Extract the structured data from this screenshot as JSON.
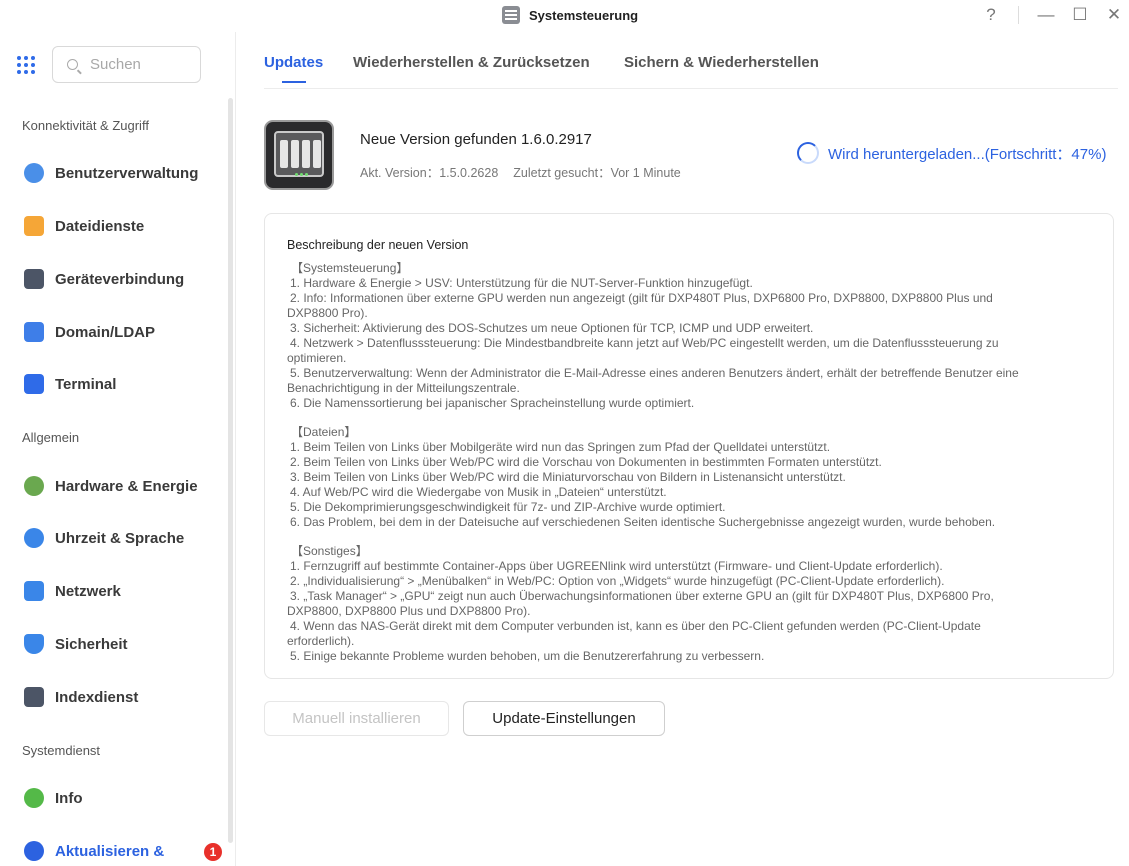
{
  "window": {
    "title": "Systemsteuerung",
    "controls": {
      "help": "?",
      "minimize": "—",
      "maximize": "☐",
      "close": "✕"
    }
  },
  "sidebar": {
    "search_placeholder": "Suchen",
    "sections": [
      "Konnektivität & Zugriff",
      "Allgemein",
      "Systemdienst"
    ],
    "items": [
      {
        "label": "Benutzerverwaltung",
        "icon": "users-icon",
        "color": "#4a8fe8"
      },
      {
        "label": "Dateidienste",
        "icon": "folder-icon",
        "color": "#f5a637"
      },
      {
        "label": "Geräteverbindung",
        "icon": "device-icon",
        "color": "#4c5566"
      },
      {
        "label": "Domain/LDAP",
        "icon": "domain-icon",
        "color": "#3e7ee8"
      },
      {
        "label": "Terminal",
        "icon": "terminal-icon",
        "color": "#2f6be8"
      },
      {
        "label": "Hardware & Energie",
        "icon": "hardware-icon",
        "color": "#6aa84f"
      },
      {
        "label": "Uhrzeit & Sprache",
        "icon": "globe-icon",
        "color": "#3a86e8"
      },
      {
        "label": "Netzwerk",
        "icon": "network-icon",
        "color": "#3a86e8"
      },
      {
        "label": "Sicherheit",
        "icon": "shield-icon",
        "color": "#3a86e8"
      },
      {
        "label": "Indexdienst",
        "icon": "index-icon",
        "color": "#4c5566"
      },
      {
        "label": "Info",
        "icon": "info-icon",
        "color": "#54b948"
      },
      {
        "label": "Aktualisieren &",
        "icon": "update-icon",
        "color": "#2c62e0",
        "badge": "1"
      }
    ]
  },
  "tabs": [
    {
      "label": "Updates"
    },
    {
      "label": "Wiederherstellen & Zurücksetzen"
    },
    {
      "label": "Sichern & Wiederherstellen"
    }
  ],
  "update": {
    "new_version": "Neue Version gefunden 1.6.0.2917",
    "current_version": "Akt. Version：1.5.0.2628",
    "last_checked": "Zuletzt gesucht：Vor 1 Minute",
    "progress_text": "Wird heruntergeladen...(Fortschritt：47%)",
    "progress_percent": 47
  },
  "notes": {
    "title": "Beschreibung der neuen Version",
    "groups": [
      [
        "【Systemsteuerung】",
        "1. Hardware & Energie > USV: Unterstützung für die NUT-Server-Funktion hinzugefügt.",
        "2. Info: Informationen über externe GPU werden nun angezeigt (gilt für DXP480T Plus, DXP6800 Pro, DXP8800, DXP8800 Plus und",
        "DXP8800 Pro).",
        "3. Sicherheit: Aktivierung des DOS-Schutzes um neue Optionen für TCP, ICMP und UDP erweitert.",
        "4. Netzwerk > Datenflusssteuerung: Die Mindestbandbreite kann jetzt auf Web/PC eingestellt werden, um die Datenflusssteuerung zu",
        "optimieren.",
        "5. Benutzerverwaltung: Wenn der Administrator die E-Mail-Adresse eines anderen Benutzers ändert, erhält der betreffende Benutzer eine",
        "Benachrichtigung in der Mitteilungszentrale.",
        "6. Die Namenssortierung bei japanischer Spracheinstellung wurde optimiert."
      ],
      [
        "【Dateien】",
        "1. Beim Teilen von Links über Mobilgeräte wird nun das Springen zum Pfad der Quelldatei unterstützt.",
        "2. Beim Teilen von Links über Web/PC wird die Vorschau von Dokumenten in bestimmten Formaten unterstützt.",
        "3. Beim Teilen von Links über Web/PC wird die Miniaturvorschau von Bildern in Listenansicht unterstützt.",
        "4. Auf Web/PC wird die Wiedergabe von Musik in „Dateien“ unterstützt.",
        "5. Die Dekomprimierungsgeschwindigkeit für 7z- und ZIP-Archive wurde optimiert.",
        "6. Das Problem, bei dem in der Dateisuche auf verschiedenen Seiten identische Suchergebnisse angezeigt wurden, wurde behoben."
      ],
      [
        "【Sonstiges】",
        "1. Fernzugriff auf bestimmte Container-Apps über UGREENlink wird unterstützt (Firmware- und Client-Update erforderlich).",
        "2. „Individualisierung“ > „Menübalken“ in Web/PC: Option von „Widgets“ wurde hinzugefügt (PC-Client-Update erforderlich).",
        "3. „Task Manager“ > „GPU“ zeigt nun auch Überwachungsinformationen über externe GPU an (gilt für DXP480T Plus, DXP6800 Pro,",
        "DXP8800, DXP8800 Plus und DXP8800 Pro).",
        "4. Wenn das NAS-Gerät direkt mit dem Computer verbunden ist, kann es über den PC-Client gefunden werden (PC-Client-Update",
        "erforderlich).",
        "5. Einige bekannte Probleme wurden behoben, um die Benutzererfahrung zu verbessern."
      ]
    ]
  },
  "buttons": {
    "manual_install": "Manuell installieren",
    "update_settings": "Update-Einstellungen"
  },
  "colors": {
    "accent": "#2c62e0",
    "badge": "#e8302a"
  }
}
